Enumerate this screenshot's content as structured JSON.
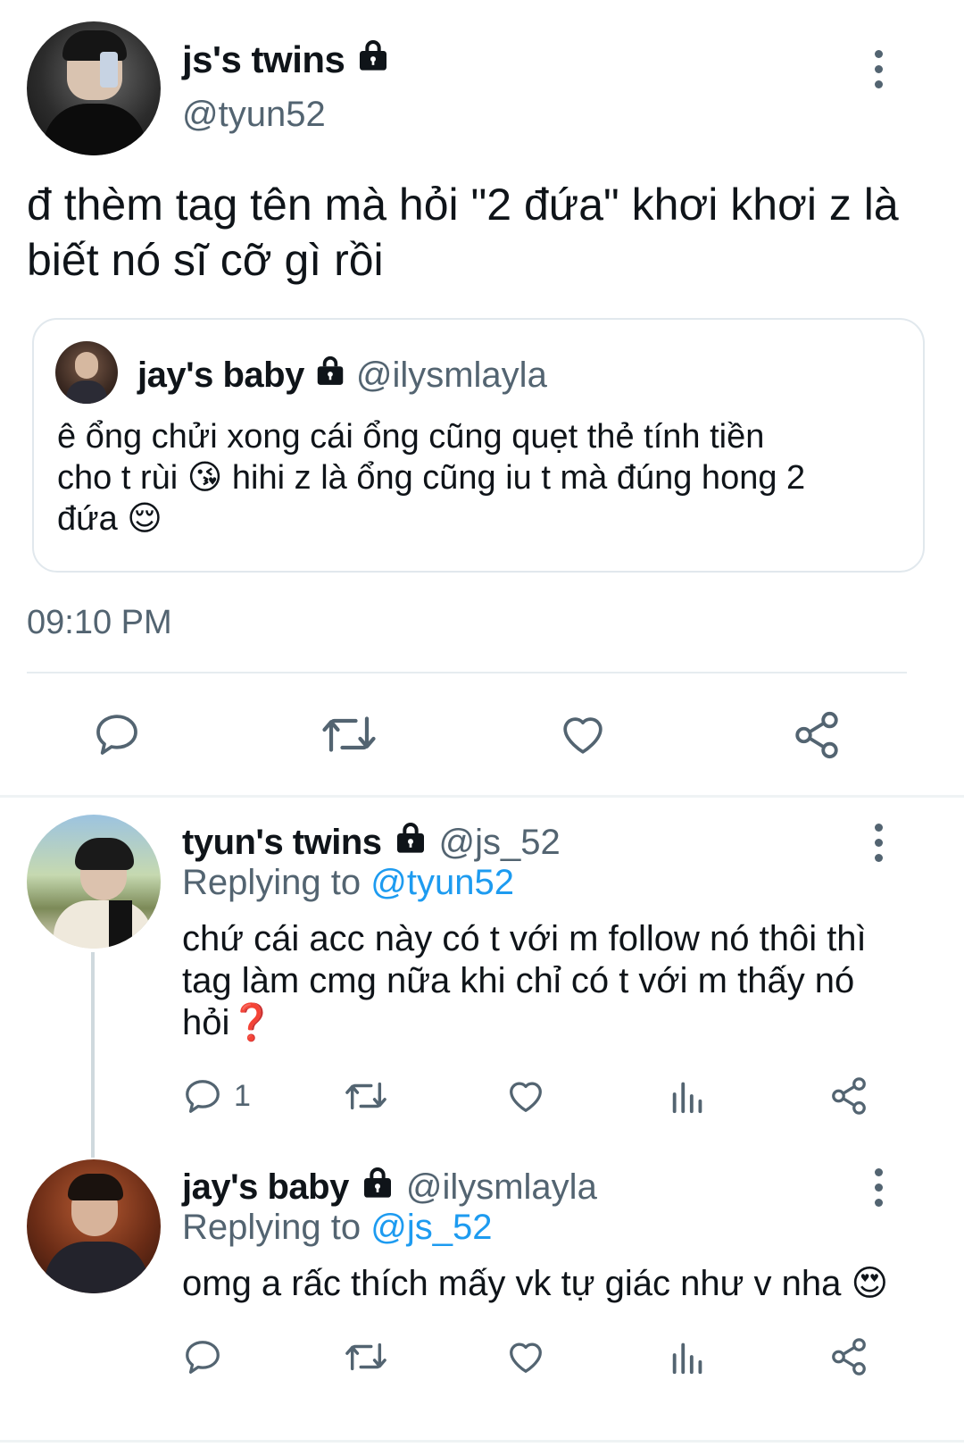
{
  "main_tweet": {
    "display_name": "js's twins",
    "handle": "@tyun52",
    "text_line1": "đ thèm tag tên mà hỏi \"2 đứa\" khơi khơi z là",
    "text_line2": "biết nó sĩ cỡ gì rồi",
    "time": "09:10 PM",
    "quoted": {
      "display_name": "jay's baby",
      "handle": "@ilysmlayla",
      "line1": "ê ổng chửi xong cái ổng cũng quẹt thẻ tính tiền",
      "line2_a": "cho t rùi",
      "line2_emoji": "😘",
      "line2_b": "hihi z là ổng cũng iu t mà đúng hong 2",
      "line3_a": "đứa",
      "line3_emoji": "😌"
    },
    "actions": [
      "reply-icon",
      "retweet-icon",
      "like-icon",
      "share-icon"
    ]
  },
  "replies": [
    {
      "display_name": "tyun's twins",
      "handle": "@js_52",
      "replying_label": "Replying to",
      "replying_to": "@tyun52",
      "line1": "chứ cái acc này có t với m follow nó thôi thì",
      "line2": "tag làm cmg nữa khi chỉ có t với m thấy nó",
      "line3": "hỏi",
      "line3_emoji": "❓",
      "reply_count": "1"
    },
    {
      "display_name": "jay's baby",
      "handle": "@ilysmlayla",
      "replying_label": "Replying to",
      "replying_to": "@js_52",
      "line1": "omg a rấc thích mấy vk tự giác như v nha",
      "line1_emoji": "😍"
    }
  ],
  "colors": {
    "text": "#0f1419",
    "secondary": "#536471",
    "accent": "#1d9bf0",
    "divider": "#eff3f4"
  }
}
